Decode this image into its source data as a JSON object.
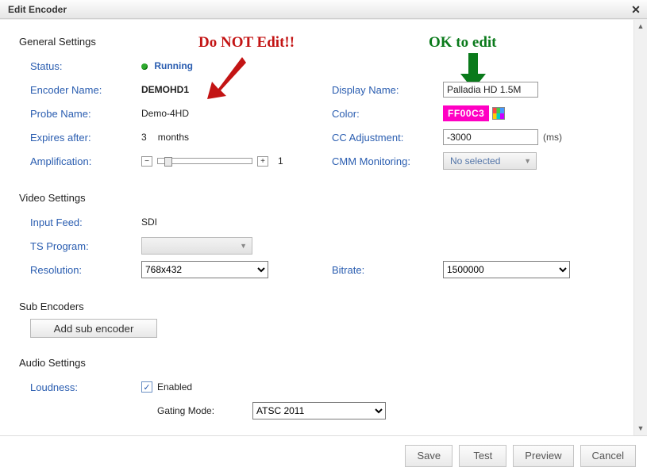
{
  "window": {
    "title": "Edit Encoder"
  },
  "annotations": {
    "doNotEdit": "Do NOT Edit!!",
    "okToEdit": "OK to edit"
  },
  "sections": {
    "general": {
      "title": "General Settings",
      "status_label": "Status:",
      "status_value": "Running",
      "encoder_name_label": "Encoder Name:",
      "encoder_name_value": "DEMOHD1",
      "probe_name_label": "Probe Name:",
      "probe_name_value": "Demo-4HD",
      "expires_label": "Expires after:",
      "expires_value": "3",
      "expires_unit": "months",
      "amplification_label": "Amplification:",
      "amplification_value": "1",
      "display_name_label": "Display Name:",
      "display_name_value": "Palladia HD 1.5M",
      "color_label": "Color:",
      "color_value": "FF00C3",
      "cc_adjust_label": "CC Adjustment:",
      "cc_adjust_value": "-3000",
      "cc_adjust_unit": "(ms)",
      "cmm_label": "CMM Monitoring:",
      "cmm_value": "No selected"
    },
    "video": {
      "title": "Video Settings",
      "input_feed_label": "Input Feed:",
      "input_feed_value": "SDI",
      "ts_program_label": "TS Program:",
      "ts_program_value": "",
      "resolution_label": "Resolution:",
      "resolution_value": "768x432",
      "bitrate_label": "Bitrate:",
      "bitrate_value": "1500000"
    },
    "sub": {
      "title": "Sub Encoders",
      "add_btn": "Add sub encoder"
    },
    "audio": {
      "title": "Audio Settings",
      "loudness_label": "Loudness:",
      "loudness_enabled_label": "Enabled",
      "loudness_enabled": true,
      "gating_mode_label": "Gating Mode:",
      "gating_mode_value": "ATSC 2011"
    }
  },
  "footer": {
    "save": "Save",
    "test": "Test",
    "preview": "Preview",
    "cancel": "Cancel"
  }
}
